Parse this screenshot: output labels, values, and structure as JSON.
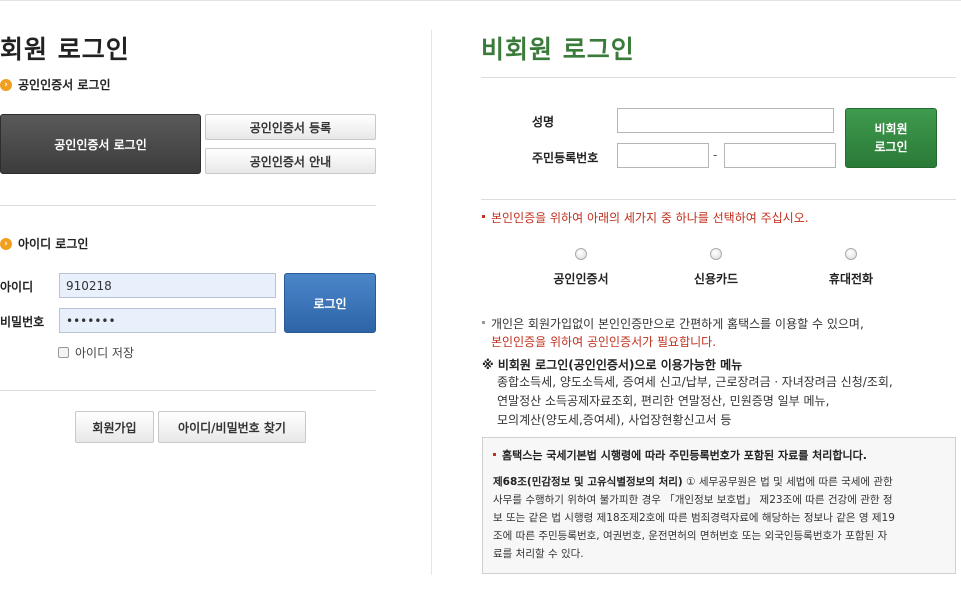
{
  "member": {
    "title": "회원 로그인",
    "cert_section": {
      "label": "공인인증서 로그인",
      "login_button": "공인인증서 로그인",
      "register_button": "공인인증서 등록",
      "guide_button": "공인인증서 안내"
    },
    "id_section": {
      "label": "아이디 로그인",
      "id_label": "아이디",
      "id_value": "910218",
      "pw_label": "비밀번호",
      "pw_value": "•••••••",
      "save_id_label": "아이디 저장",
      "login_button": "로그인"
    },
    "signup_button": "회원가입",
    "find_button": "아이디/비밀번호 찾기"
  },
  "nonmember": {
    "title": "비회원 로그인",
    "name_label": "성명",
    "rrn_label": "주민등록번호",
    "rrn_separator": "-",
    "login_button_line1": "비회원",
    "login_button_line2": "로그인",
    "verify_notice": "본인인증을 위하여 아래의 세가지 중 하나를 선택하여 주십시오.",
    "options": [
      "공인인증서",
      "신용카드",
      "휴대전화"
    ],
    "info_line1": "개인은 회원가입없이 본인인증만으로 간편하게 홈택스를 이용할 수 있으며,",
    "info_line2": "본인인증을 위하여 공인인증서가 필요합니다.",
    "menu_title": "※ 비회원 로그인(공인인증서)으로 이용가능한 메뉴",
    "menu_lines": [
      "종합소득세, 양도소득세, 증여세 신고/납부, 근로장려금ㆍ자녀장려금 신청/조회,",
      "연말정산 소득공제자료조회, 편리한 연말정산, 민원증명 일부 메뉴,",
      "모의계산(양도세,증여세), 사업장현황신고서 등"
    ],
    "privacy": {
      "title": "홈택스는 국세기본법 시행령에 따라 주민등록번호가 포함된 자료를 처리합니다.",
      "article": "제68조(민감정보 및 고유식별정보의 처리)",
      "lines": [
        " ① 세무공무원은 법 및 세법에 따른 국세에 관한",
        "사무를 수행하기 위하여 불가피한 경우 「개인정보 보호법」 제23조에 따른 건강에 관한 정",
        "보 또는 같은 법 시행령 제18조제2호에 따른 범죄경력자료에 해당하는 정보나 같은 영 제19",
        "조에 따른 주민등록번호, 여권번호, 운전면허의 면허번호 또는 외국인등록번호가 포함된 자",
        "료를 처리할 수 있다."
      ]
    }
  }
}
